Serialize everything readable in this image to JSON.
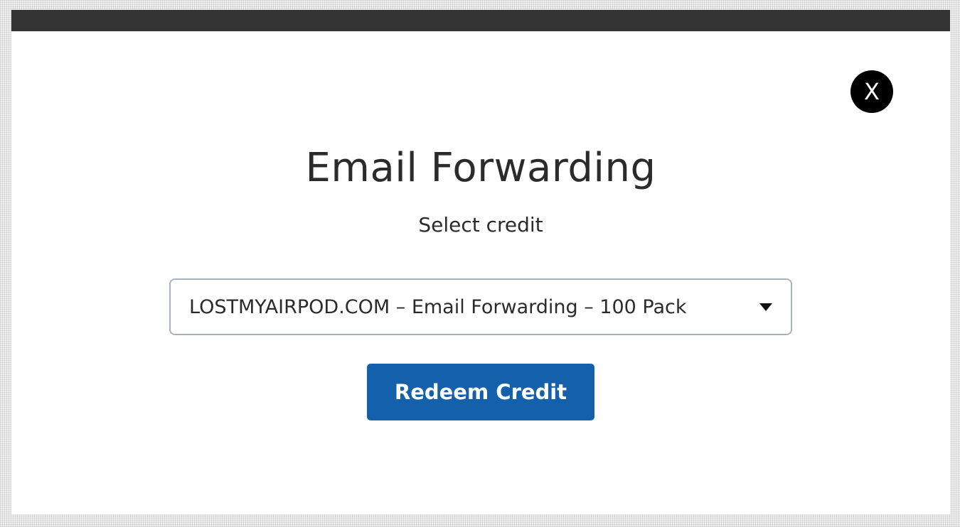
{
  "modal": {
    "close_label": "X",
    "title": "Email Forwarding",
    "subtitle": "Select credit",
    "credit_select": {
      "selected_value": "LOSTMYAIRPOD.COM – Email Forwarding – 100 Pack"
    },
    "redeem_label": "Redeem Credit"
  },
  "colors": {
    "topbar": "#333333",
    "primary_button": "#1460aa",
    "close_button": "#000000",
    "select_border": "#a9b3bb"
  },
  "icons": {
    "close": "close-icon",
    "dropdown": "caret-down-icon"
  }
}
